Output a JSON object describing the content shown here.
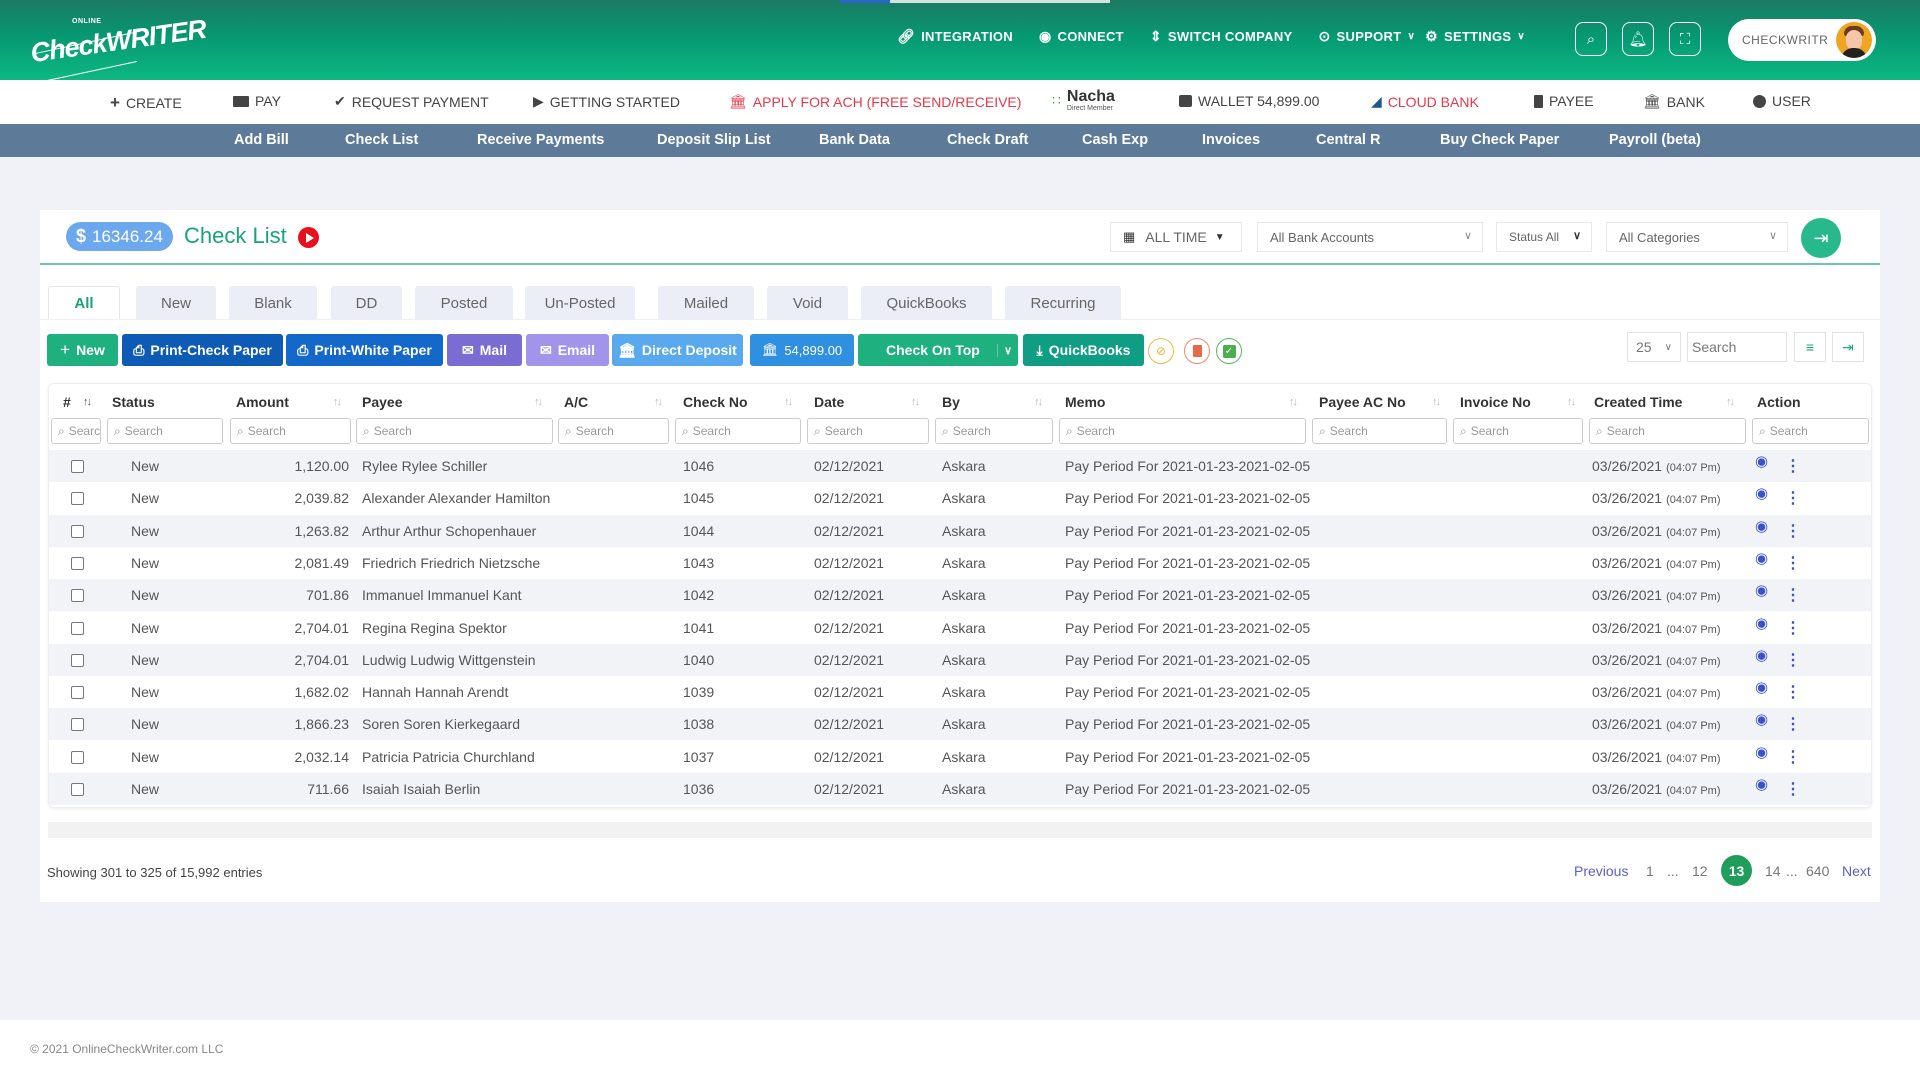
{
  "app": {
    "logo_top": "ONLINE",
    "logo_word": "CheckWRITER"
  },
  "topnav": {
    "items": [
      {
        "label": "INTEGRATION",
        "icon": "link-icon"
      },
      {
        "label": "CONNECT",
        "icon": "connect-icon"
      },
      {
        "label": "SWITCH COMPANY",
        "icon": "switch-icon"
      },
      {
        "label": "SUPPORT",
        "icon": "support-icon",
        "dropdown": true
      },
      {
        "label": "SETTINGS",
        "icon": "gear-icon",
        "dropdown": true
      }
    ],
    "user_label": "CHECKWRITR"
  },
  "secnav": {
    "items": [
      {
        "label": "CREATE",
        "icon": "plus-icon"
      },
      {
        "label": "PAY",
        "icon": "pay-icon"
      },
      {
        "label": "REQUEST PAYMENT",
        "icon": "check-circle-icon"
      },
      {
        "label": "GETTING STARTED",
        "icon": "play-icon"
      },
      {
        "label": "APPLY FOR ACH (FREE SEND/RECEIVE)",
        "icon": "bank-icon"
      },
      {
        "label": "Nacha",
        "sublabel": "Direct Member"
      },
      {
        "label": "WALLET 54,899.00",
        "icon": "wallet-icon"
      },
      {
        "label": "CLOUD BANK",
        "icon": "cloud-bank-icon"
      },
      {
        "label": "PAYEE",
        "icon": "payee-icon"
      },
      {
        "label": "BANK",
        "icon": "bank-icon"
      },
      {
        "label": "USER",
        "icon": "user-icon"
      }
    ],
    "accent_red": "#e8394a"
  },
  "subnav": {
    "items": [
      "Add Bill",
      "Check List",
      "Receive Payments",
      "Deposit Slip List",
      "Bank Data",
      "Check Draft",
      "Cash Exp",
      "Invoices",
      "Central R",
      "Buy Check Paper",
      "Payroll (beta)"
    ]
  },
  "header": {
    "balance_symbol": "$",
    "balance": "16346.24",
    "title": "Check List",
    "date_filter": "ALL TIME",
    "bank_filter": "All Bank Accounts",
    "status_filter": "Status All",
    "category_filter": "All Categories"
  },
  "tabs": [
    "All",
    "New",
    "Blank",
    "DD",
    "Posted",
    "Un-Posted",
    "Mailed",
    "Void",
    "QuickBooks",
    "Recurring"
  ],
  "toolbar": {
    "new": "New",
    "print_check": "Print-Check Paper",
    "print_white": "Print-White Paper",
    "mail": "Mail",
    "email": "Email",
    "direct_deposit": "Direct Deposit",
    "wallet_amount": "54,899.00",
    "check_on_top": "Check On Top",
    "quickbooks": "QuickBooks",
    "page_size": "25",
    "search_placeholder": "Search"
  },
  "table": {
    "columns": [
      "#",
      "Status",
      "Amount",
      "Payee",
      "A/C",
      "Check No",
      "Date",
      "By",
      "Memo",
      "Payee AC No",
      "Invoice No",
      "Created Time",
      "Action"
    ],
    "filter_placeholder": "Search",
    "rows": [
      {
        "status": "New",
        "amount": "1,120.00",
        "payee": "Rylee Rylee Schiller",
        "ac": "",
        "check_no": "1046",
        "date": "02/12/2021",
        "by": "Askara",
        "memo": "Pay Period For 2021-01-23-2021-02-05",
        "payee_ac": "",
        "invoice": "",
        "created": "03/26/2021",
        "created_time": "(04:07 Pm)"
      },
      {
        "status": "New",
        "amount": "2,039.82",
        "payee": "Alexander Alexander Hamilton",
        "ac": "",
        "check_no": "1045",
        "date": "02/12/2021",
        "by": "Askara",
        "memo": "Pay Period For 2021-01-23-2021-02-05",
        "payee_ac": "",
        "invoice": "",
        "created": "03/26/2021",
        "created_time": "(04:07 Pm)"
      },
      {
        "status": "New",
        "amount": "1,263.82",
        "payee": "Arthur Arthur Schopenhauer",
        "ac": "",
        "check_no": "1044",
        "date": "02/12/2021",
        "by": "Askara",
        "memo": "Pay Period For 2021-01-23-2021-02-05",
        "payee_ac": "",
        "invoice": "",
        "created": "03/26/2021",
        "created_time": "(04:07 Pm)"
      },
      {
        "status": "New",
        "amount": "2,081.49",
        "payee": "Friedrich Friedrich Nietzsche",
        "ac": "",
        "check_no": "1043",
        "date": "02/12/2021",
        "by": "Askara",
        "memo": "Pay Period For 2021-01-23-2021-02-05",
        "payee_ac": "",
        "invoice": "",
        "created": "03/26/2021",
        "created_time": "(04:07 Pm)"
      },
      {
        "status": "New",
        "amount": "701.86",
        "payee": "Immanuel Immanuel Kant",
        "ac": "",
        "check_no": "1042",
        "date": "02/12/2021",
        "by": "Askara",
        "memo": "Pay Period For 2021-01-23-2021-02-05",
        "payee_ac": "",
        "invoice": "",
        "created": "03/26/2021",
        "created_time": "(04:07 Pm)"
      },
      {
        "status": "New",
        "amount": "2,704.01",
        "payee": "Regina Regina Spektor",
        "ac": "",
        "check_no": "1041",
        "date": "02/12/2021",
        "by": "Askara",
        "memo": "Pay Period For 2021-01-23-2021-02-05",
        "payee_ac": "",
        "invoice": "",
        "created": "03/26/2021",
        "created_time": "(04:07 Pm)"
      },
      {
        "status": "New",
        "amount": "2,704.01",
        "payee": "Ludwig Ludwig Wittgenstein",
        "ac": "",
        "check_no": "1040",
        "date": "02/12/2021",
        "by": "Askara",
        "memo": "Pay Period For 2021-01-23-2021-02-05",
        "payee_ac": "",
        "invoice": "",
        "created": "03/26/2021",
        "created_time": "(04:07 Pm)"
      },
      {
        "status": "New",
        "amount": "1,682.02",
        "payee": "Hannah Hannah Arendt",
        "ac": "",
        "check_no": "1039",
        "date": "02/12/2021",
        "by": "Askara",
        "memo": "Pay Period For 2021-01-23-2021-02-05",
        "payee_ac": "",
        "invoice": "",
        "created": "03/26/2021",
        "created_time": "(04:07 Pm)"
      },
      {
        "status": "New",
        "amount": "1,866.23",
        "payee": "Soren Soren Kierkegaard",
        "ac": "",
        "check_no": "1038",
        "date": "02/12/2021",
        "by": "Askara",
        "memo": "Pay Period For 2021-01-23-2021-02-05",
        "payee_ac": "",
        "invoice": "",
        "created": "03/26/2021",
        "created_time": "(04:07 Pm)"
      },
      {
        "status": "New",
        "amount": "2,032.14",
        "payee": "Patricia Patricia Churchland",
        "ac": "",
        "check_no": "1037",
        "date": "02/12/2021",
        "by": "Askara",
        "memo": "Pay Period For 2021-01-23-2021-02-05",
        "payee_ac": "",
        "invoice": "",
        "created": "03/26/2021",
        "created_time": "(04:07 Pm)"
      },
      {
        "status": "New",
        "amount": "711.66",
        "payee": "Isaiah Isaiah Berlin",
        "ac": "",
        "check_no": "1036",
        "date": "02/12/2021",
        "by": "Askara",
        "memo": "Pay Period For 2021-01-23-2021-02-05",
        "payee_ac": "",
        "invoice": "",
        "created": "03/26/2021",
        "created_time": "(04:07 Pm)"
      }
    ]
  },
  "pagination": {
    "showing": "Showing 301 to 325 of 15,992 entries",
    "previous": "Previous",
    "next": "Next",
    "pages": [
      "1",
      "...",
      "12",
      "13",
      "14",
      "...",
      "640"
    ],
    "current": "13"
  },
  "colors": {
    "brand_green": "#0db882",
    "active_page": "#1e9e5a",
    "link_blue": "#5a5fc8",
    "subnav_bg": "#5d7a98"
  },
  "footer": {
    "copyright": "© 2021 OnlineCheckWriter.com LLC"
  }
}
